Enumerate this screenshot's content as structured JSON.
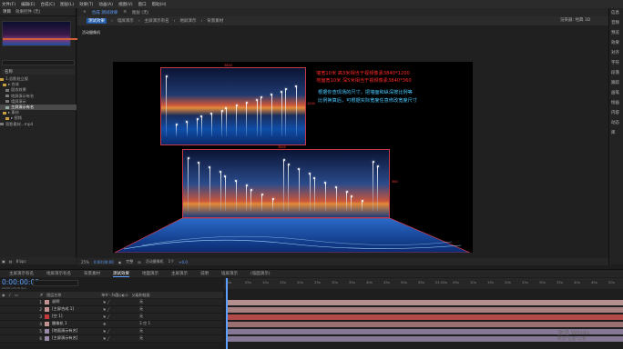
{
  "menu": [
    "文件(F)",
    "编辑(E)",
    "合成(C)",
    "图层(L)",
    "效果(T)",
    "动画(A)",
    "视图(V)",
    "窗口",
    "帮助(H)"
  ],
  "project_panel": {
    "tabs": [
      "项目",
      "效果控件 (无)"
    ],
    "search_placeholder": "",
    "column_header": "名称",
    "items": [
      {
        "label": "1.总影处立规",
        "color": "#c8a040",
        "selected": false
      },
      {
        "label": "▸ 合成",
        "color": "#c8a040",
        "selected": false
      },
      {
        "label": "固态效果",
        "color": "#7a7a7a",
        "selected": false
      },
      {
        "label": "地屏演示有名",
        "color": "#7a7a7a",
        "selected": false
      },
      {
        "label": "墙屏演示",
        "color": "#7a7a7a",
        "selected": false
      },
      {
        "label": "主屏演示有名",
        "color": "#7a7a7a",
        "selected": true
      },
      {
        "label": "▸ 素材",
        "color": "#c8a040",
        "selected": false
      },
      {
        "label": "▸ 视频",
        "color": "#c8a040",
        "selected": false
      },
      {
        "label": "背影素材...mp4",
        "color": "#7a7a7a",
        "selected": false
      }
    ],
    "footer": "8 bpc"
  },
  "viewer": {
    "tab_active": "合成 测试效果",
    "tab_layer": "图层 (无)",
    "breadcrumbs": [
      "测试效果",
      "墙屏演示",
      "主屏演示有名",
      "地屏演示",
      "背景素材"
    ],
    "renderer": "渲染器: 经典 3D",
    "comp_label": "活动摄像机",
    "red_text": [
      "墙宽10米 高3米相当于视频像素3840*1200",
      "地面宽10米 深5米相当于视频像素3840*360"
    ],
    "cyan_text": [
      "根据你查现场的尺寸，把墙面和纵深按比例等",
      "比例换算后，可根据实际宽度任意修改宽度尺寸"
    ],
    "dim_top": "3840",
    "dim_side": "1200",
    "dim_floor": "3840",
    "dim_floor_side": "360",
    "footer": [
      "25%",
      "0:00:00:00",
      "完整",
      "活动摄像机",
      "1个",
      "+0.0"
    ]
  },
  "right_panel": [
    "信息",
    "音频",
    "预览",
    "效果",
    "对齐",
    "字符",
    "段落",
    "跟踪",
    "画笔",
    "绘画",
    "内容",
    "动态",
    "库"
  ],
  "timeline": {
    "tabs": [
      "主屏演示有名",
      "地屏演示有名",
      "背景素材",
      "测试效果",
      "地面演示",
      "主屏演示",
      "说明",
      "墙屏演示",
      "(墙面演示)"
    ],
    "active_tab": "测试效果",
    "timecode": "0:00:00:00",
    "subtime": "00000 (25.00 fps)",
    "header": [
      "#",
      "图层名称",
      "单※＼fx圆◎◐⊙",
      "父级和链接"
    ],
    "ruler": [
      "0s",
      "05s",
      "10s",
      "15s",
      "20s",
      "25s",
      "30s",
      "35s",
      "40s",
      "45s",
      "50s",
      "55s",
      "01:00s",
      "05s",
      "10s",
      "15s",
      "20s",
      "25s",
      "30s",
      "35s",
      "40s",
      "45s",
      "50s"
    ],
    "layers": [
      {
        "num": "1",
        "name": "说明",
        "color": "#c49090",
        "parent": "无"
      },
      {
        "num": "2",
        "name": "[主屏合成 1]",
        "color": "#c49090",
        "parent": "无"
      },
      {
        "num": "3",
        "name": "[空 1]",
        "color": "#c43a3a",
        "parent": "无"
      },
      {
        "num": "4",
        "name": "摄像机 1",
        "color": "#c49090",
        "parent": "3.空 1"
      },
      {
        "num": "5",
        "name": "[地面演示有名]",
        "color": "#9a8aa8",
        "parent": "无"
      },
      {
        "num": "6",
        "name": "[主屏演示有名]",
        "color": "#9a8aa8",
        "parent": "无"
      }
    ]
  },
  "watermark": [
    "激活 Windo",
    "转到\"设置\"以激"
  ]
}
